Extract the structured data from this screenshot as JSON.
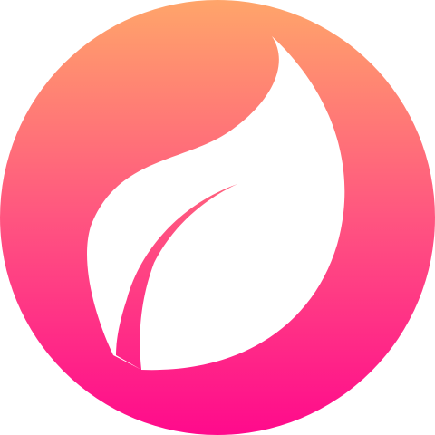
{
  "logo": {
    "name": "leaf-app-logo",
    "icon": "leaf-icon",
    "colors": {
      "gradient_top": "#FFA56A",
      "gradient_mid": "#FF5580",
      "gradient_bottom": "#FF0A8C",
      "leaf": "#FFFFFF"
    }
  }
}
